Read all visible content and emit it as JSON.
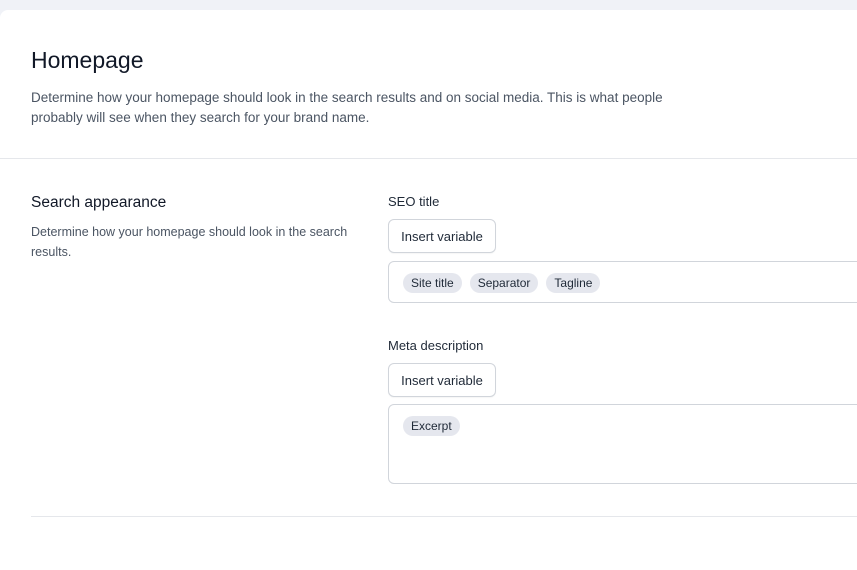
{
  "header": {
    "title": "Homepage",
    "description": "Determine how your homepage should look in the search results and on social media. This is what people probably will see when they search for your brand name."
  },
  "search_appearance": {
    "title": "Search appearance",
    "description": "Determine how your homepage should look in the search results."
  },
  "seo_title": {
    "label": "SEO title",
    "insert_button": "Insert variable",
    "chips": [
      "Site title",
      "Separator",
      "Tagline"
    ]
  },
  "meta_description": {
    "label": "Meta description",
    "insert_button": "Insert variable",
    "chips": [
      "Excerpt"
    ]
  }
}
